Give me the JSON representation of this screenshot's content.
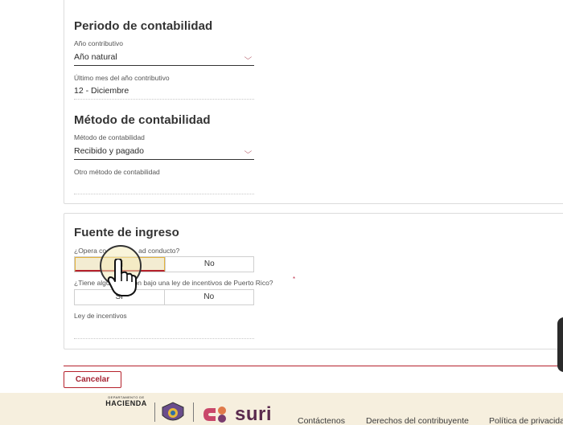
{
  "periodo": {
    "title": "Periodo de contabilidad",
    "ano_label": "Año contributivo",
    "ano_value": "Año natural",
    "ultimo_mes_label": "Último mes del año contributivo",
    "ultimo_mes_value": "12 - Diciembre"
  },
  "metodo": {
    "title": "Método de contabilidad",
    "metodo_label": "Método de contabilidad",
    "metodo_value": "Recibido y pagado",
    "otro_label": "Otro método de contabilidad",
    "otro_value": ""
  },
  "fuente": {
    "title": "Fuente de ingreso",
    "q1_label": "¿Opera co",
    "q1_hidden_label": "ad conducto?",
    "q1_yes": "Sí",
    "q1_no": "No",
    "q1_selected": "Sí",
    "q2_label": "¿Tiene algu",
    "q2_label_rest": "ón bajo una ley de incentivos de Puerto Rico?",
    "q2_required": "*",
    "q2_yes": "Sí",
    "q2_no": "No",
    "ley_label": "Ley de incentivos",
    "ley_value": ""
  },
  "actions": {
    "cancel_label": "Cancelar"
  },
  "footer": {
    "hacienda_small": "DEPARTAMENTO DE",
    "hacienda_big": "HACIENDA",
    "suri": "suri",
    "links": [
      "Contáctenos",
      "Derechos del contribuyente",
      "Política de privacidad"
    ]
  },
  "colors": {
    "accent": "#b5212c",
    "selected_bg": "#f3ecd2",
    "footer_bg": "#f6efde",
    "suri_purple": "#5a2a4e"
  },
  "icons": [
    "chevron-down-icon",
    "hacienda-seal-icon",
    "suri-logo-icon",
    "hand-pointer-icon"
  ]
}
